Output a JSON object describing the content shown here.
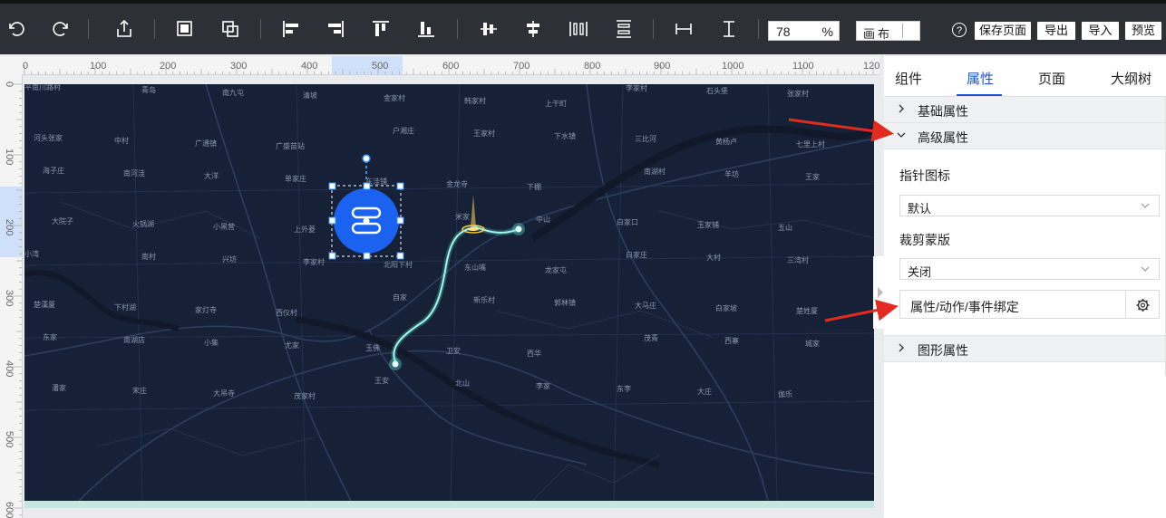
{
  "toolbar": {
    "zoom_value": "78",
    "zoom_unit": "%",
    "canvas_label": "画布",
    "help_label": "?",
    "save_page": "保存页面",
    "export": "导出",
    "import": "导入",
    "preview": "预览"
  },
  "ruler": {
    "top_ticks": [
      "0",
      "100",
      "200",
      "300",
      "400",
      "500",
      "600",
      "700",
      "800",
      "900",
      "1000",
      "1100",
      "120"
    ],
    "left_ticks": [
      "0",
      "100",
      "200",
      "300",
      "400",
      "500",
      "600"
    ]
  },
  "map": {
    "labels": [
      "平南川路村",
      "青岛",
      "南九屯",
      "清坡",
      "金家村",
      "韩家村",
      "上干町",
      "李家村",
      "石头堡",
      "张家村",
      "河头张家",
      "中村",
      "广通镇",
      "广盛苗站",
      "户湘庄",
      "王家村",
      "下水镇",
      "三比河",
      "黄杨卢",
      "七里上村",
      "海子庄",
      "南河洼",
      "大洋",
      "单家庄",
      "东洼铺",
      "金龙寺",
      "下棚",
      "南湖村",
      "羊坊",
      "王家",
      "大院子",
      "火锅湖",
      "小黑营",
      "上外菱",
      "家厂庄",
      "米家",
      "中山",
      "白家口",
      "玉家铺",
      "五山",
      "小湾",
      "南村",
      "兴坊",
      "李家村",
      "北阳下村",
      "东山嘴",
      "龙家屯",
      "白家庄",
      "大村",
      "三湾村",
      "楚漢厦",
      "下村湖",
      "家灯寺",
      "西仪村",
      "自家",
      "新乐村",
      "郭林镇",
      "大马庄",
      "白家坡",
      "楚姓厦",
      "东家",
      "南湖店",
      "小集",
      "尤家",
      "玉佛",
      "卫安",
      "西华",
      "茂青",
      "西寨",
      "城家",
      "潘家",
      "宋庄",
      "大吊寺",
      "茂家村",
      "王安",
      "北山",
      "李家",
      "东李",
      "大庄",
      "伽乐"
    ]
  },
  "panel": {
    "tabs": [
      "组件",
      "属性",
      "页面",
      "大纲树"
    ],
    "active_tab": "属性",
    "sections": {
      "basic": "基础属性",
      "advanced": "高级属性",
      "graphic": "图形属性"
    },
    "pointer_icon_label": "指针图标",
    "pointer_icon_value": "默认",
    "clip_mask_label": "裁剪蒙版",
    "clip_mask_value": "关闭",
    "binding_label": "属性/动作/事件绑定"
  },
  "colors": {
    "toolbar_bg": "#2d3036",
    "map_bg": "#162138",
    "accent": "#1557d4",
    "route_glow": "#6ff2da",
    "arrow": "#e32a1e",
    "icon_circle": "#1a62ef"
  }
}
